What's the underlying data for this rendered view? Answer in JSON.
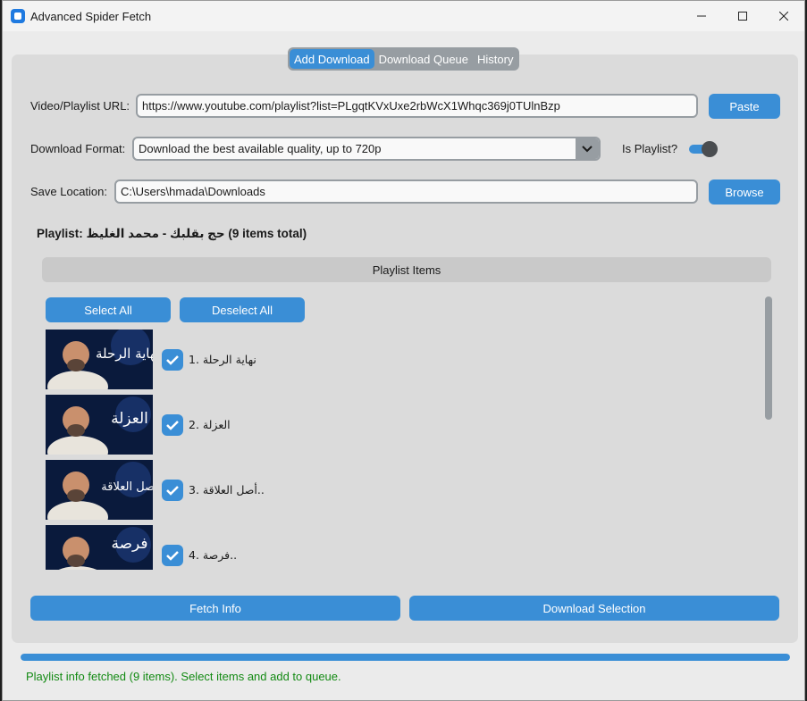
{
  "window": {
    "title": "Advanced Spider Fetch",
    "controls": {
      "minimize": "minimize-icon",
      "maximize": "maximize-icon",
      "close": "close-icon"
    }
  },
  "tabs": [
    {
      "label": "Add Download",
      "active": true
    },
    {
      "label": "Download Queue",
      "active": false
    },
    {
      "label": "History",
      "active": false
    }
  ],
  "form": {
    "url_label": "Video/Playlist URL:",
    "url_value": "https://www.youtube.com/playlist?list=PLgqtKVxUxe2rbWcX1Whqc369j0TUlnBzp",
    "paste_label": "Paste",
    "format_label": "Download Format:",
    "format_value": "Download the best available quality, up to 720p",
    "is_playlist_label": "Is Playlist?",
    "is_playlist_on": true,
    "save_label": "Save Location:",
    "save_value": "C:\\Users\\hmada\\Downloads",
    "browse_label": "Browse"
  },
  "playlist": {
    "title": "Playlist: حج بقلبك - محمد الغليظ (9 items total)",
    "header": "Playlist Items",
    "select_all": "Select All",
    "deselect_all": "Deselect All",
    "items": [
      {
        "label": "1. نهاية الرحلة",
        "checked": true,
        "thumb_text": "نهاية الرحلة"
      },
      {
        "label": "2. العزلة",
        "checked": true,
        "thumb_text": "العزلة"
      },
      {
        "label": "3. أصل العلاقة..",
        "checked": true,
        "thumb_text": "أصل العلاقة"
      },
      {
        "label": "4. فرصة..",
        "checked": true,
        "thumb_text": "فرصة"
      }
    ]
  },
  "actions": {
    "fetch_info": "Fetch Info",
    "download_selection": "Download Selection"
  },
  "progress_fraction": 1.0,
  "status": "Playlist info fetched (9 items). Select items and add to queue.",
  "colors": {
    "accent": "#3a8ed6",
    "status_text": "#138a13",
    "panel": "#dbdbdb",
    "border": "#979da2"
  }
}
